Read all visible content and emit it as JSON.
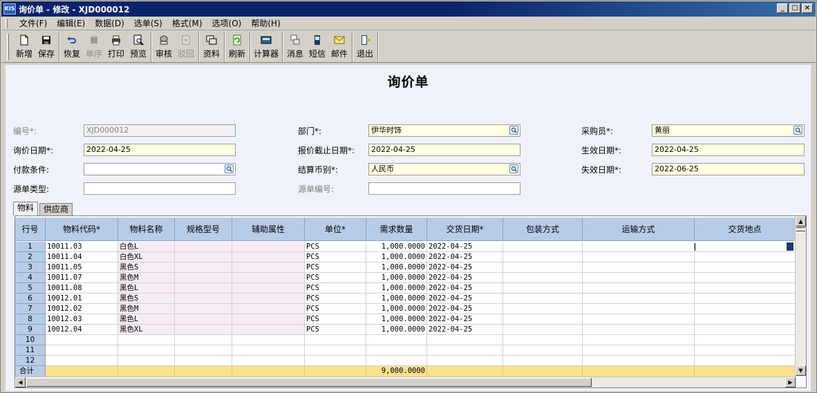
{
  "window": {
    "logo_text": "KIS",
    "title": "询价单 - 修改 - XJD000012",
    "controls": [
      "_",
      "□",
      "×"
    ]
  },
  "menu": [
    {
      "label": "文件(F)"
    },
    {
      "label": "编辑(E)"
    },
    {
      "label": "数据(D)"
    },
    {
      "label": "选单(S)"
    },
    {
      "label": "格式(M)"
    },
    {
      "label": "选项(O)"
    },
    {
      "label": "帮助(H)"
    }
  ],
  "toolbar": {
    "groups": [
      [
        {
          "label": "新增",
          "icon": "new-doc-icon"
        },
        {
          "label": "保存",
          "icon": "save-icon"
        }
      ],
      [
        {
          "label": "恢复",
          "icon": "undo-icon"
        },
        {
          "label": "单序",
          "icon": "sequence-icon",
          "disabled": true
        },
        {
          "label": "打印",
          "icon": "print-icon"
        },
        {
          "label": "预览",
          "icon": "preview-icon"
        }
      ],
      [
        {
          "label": "审核",
          "icon": "audit-icon"
        },
        {
          "label": "驳回",
          "icon": "reject-icon",
          "disabled": true
        }
      ],
      [
        {
          "label": "资料",
          "icon": "data-icon"
        }
      ],
      [
        {
          "label": "刷新",
          "icon": "refresh-icon"
        }
      ],
      [
        {
          "label": "计算器",
          "icon": "calculator-icon"
        }
      ],
      [
        {
          "label": "消息",
          "icon": "message-icon"
        },
        {
          "label": "短信",
          "icon": "sms-icon"
        },
        {
          "label": "邮件",
          "icon": "mail-icon"
        }
      ],
      [
        {
          "label": "退出",
          "icon": "exit-icon"
        }
      ]
    ]
  },
  "form": {
    "title": "询价单",
    "fields": {
      "number_label": "编号*:",
      "number_value": "XJD000012",
      "inquiry_date_label": "询价日期*:",
      "inquiry_date_value": "2022-04-25",
      "payment_terms_label": "付款条件:",
      "payment_terms_value": "",
      "source_type_label": "源单类型:",
      "source_type_value": "",
      "department_label": "部门*:",
      "department_value": "伊华时饰",
      "quote_deadline_label": "报价截止日期*:",
      "quote_deadline_value": "2022-04-25",
      "currency_label": "结算币别*:",
      "currency_value": "人民币",
      "source_number_label": "源单编号:",
      "source_number_value": "",
      "buyer_label": "采购员*:",
      "buyer_value": "黄丽",
      "effective_date_label": "生效日期*:",
      "effective_date_value": "2022-04-25",
      "expiry_date_label": "失效日期*:",
      "expiry_date_value": "2022-06-25"
    }
  },
  "tabs": [
    {
      "label": "物料",
      "active": true
    },
    {
      "label": "供应商",
      "active": false
    }
  ],
  "grid": {
    "columns": [
      "行号",
      "物料代码*",
      "物料名称",
      "规格型号",
      "辅助属性",
      "单位*",
      "需求数量",
      "交货日期*",
      "包装方式",
      "运输方式",
      "交货地点"
    ],
    "rows": [
      [
        "1",
        "10011.03",
        "白色L",
        "",
        "",
        "PCS",
        "1,000.0000",
        "2022-04-25",
        "",
        "",
        ""
      ],
      [
        "2",
        "10011.04",
        "白色XL",
        "",
        "",
        "PCS",
        "1,000.0000",
        "2022-04-25",
        "",
        "",
        ""
      ],
      [
        "3",
        "10011.05",
        "黑色S",
        "",
        "",
        "PCS",
        "1,000.0000",
        "2022-04-25",
        "",
        "",
        ""
      ],
      [
        "4",
        "10011.07",
        "黑色M",
        "",
        "",
        "PCS",
        "1,000.0000",
        "2022-04-25",
        "",
        "",
        ""
      ],
      [
        "5",
        "10011.08",
        "黑色L",
        "",
        "",
        "PCS",
        "1,000.0000",
        "2022-04-25",
        "",
        "",
        ""
      ],
      [
        "6",
        "10012.01",
        "黑色S",
        "",
        "",
        "PCS",
        "1,000.0000",
        "2022-04-25",
        "",
        "",
        ""
      ],
      [
        "7",
        "10012.02",
        "黑色M",
        "",
        "",
        "PCS",
        "1,000.0000",
        "2022-04-25",
        "",
        "",
        ""
      ],
      [
        "8",
        "10012.03",
        "黑色L",
        "",
        "",
        "PCS",
        "1,000.0000",
        "2022-04-25",
        "",
        "",
        ""
      ],
      [
        "9",
        "10012.04",
        "黑色XL",
        "",
        "",
        "PCS",
        "1,000.0000",
        "2022-04-25",
        "",
        "",
        ""
      ],
      [
        "10",
        "",
        "",
        "",
        "",
        "",
        "",
        "",
        "",
        "",
        ""
      ],
      [
        "11",
        "",
        "",
        "",
        "",
        "",
        "",
        "",
        "",
        "",
        ""
      ],
      [
        "12",
        "",
        "",
        "",
        "",
        "",
        "",
        "",
        "",
        "",
        ""
      ]
    ],
    "total": {
      "label": "合计",
      "quantity": "9,000.0000"
    }
  },
  "colors": {
    "title_bar": "#0a246a",
    "header_bg": "#b8cce8",
    "required_field_bg": "#ffffe1",
    "total_row_bg": "#ffe08c",
    "content_bg": "#f0f2fb"
  }
}
